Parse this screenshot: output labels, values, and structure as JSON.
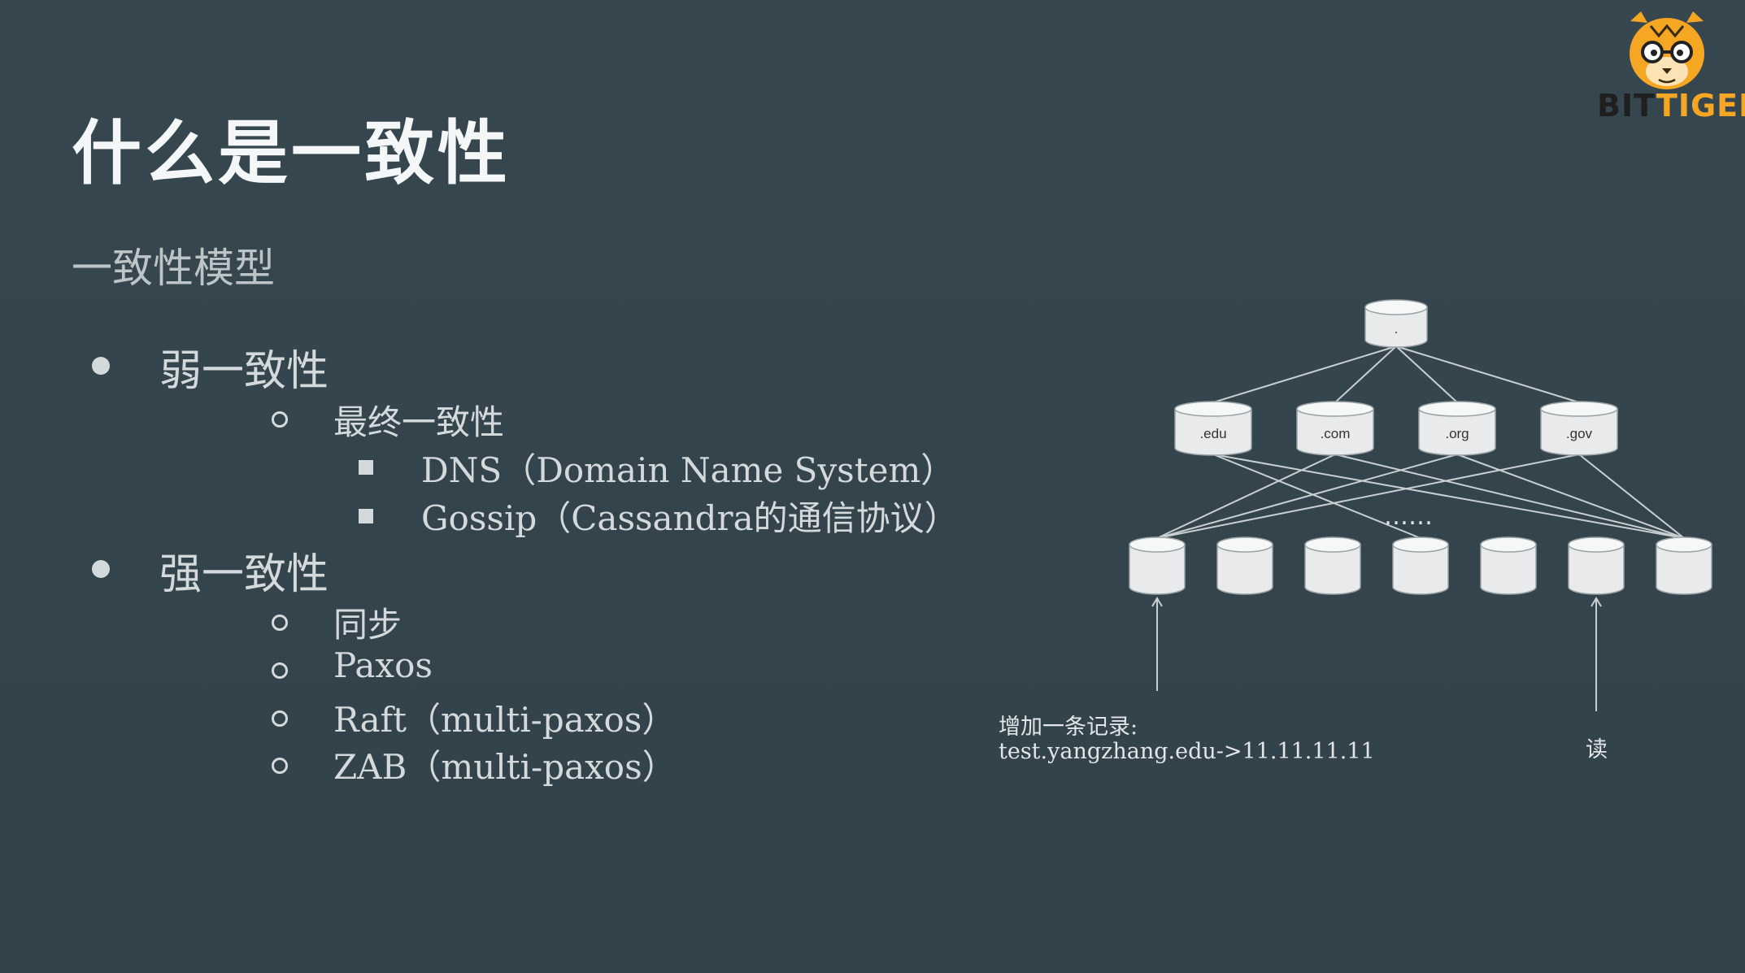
{
  "slide": {
    "title": "什么是一致性",
    "subtitle": "一致性模型",
    "weak": {
      "label": "弱一致性",
      "eventual": {
        "label": "最终一致性",
        "items": [
          "DNS（Domain Name System）",
          "Gossip（Cassandra的通信协议）"
        ]
      }
    },
    "strong": {
      "label": "强一致性",
      "items": [
        "同步",
        "Paxos",
        "Raft（multi-paxos）",
        "ZAB（multi-paxos）"
      ]
    }
  },
  "logo": {
    "bit": "BIT",
    "tiger": "TIGER"
  },
  "diagram": {
    "root_label": ".",
    "tld_labels": [
      ".edu",
      ".com",
      ".org",
      ".gov"
    ],
    "ellipsis": "……",
    "write_caption_line1": "增加一条记录:",
    "write_caption_line2": "test.yangzhang.edu->11.11.11.11",
    "read_caption": "读"
  },
  "colors": {
    "background": "#34444c",
    "text": "#d4d9dc",
    "title": "#f4f6f7",
    "logo_orange": "#f5a623",
    "node_fill": "#e8eaeb",
    "edge": "#c9ced1"
  }
}
